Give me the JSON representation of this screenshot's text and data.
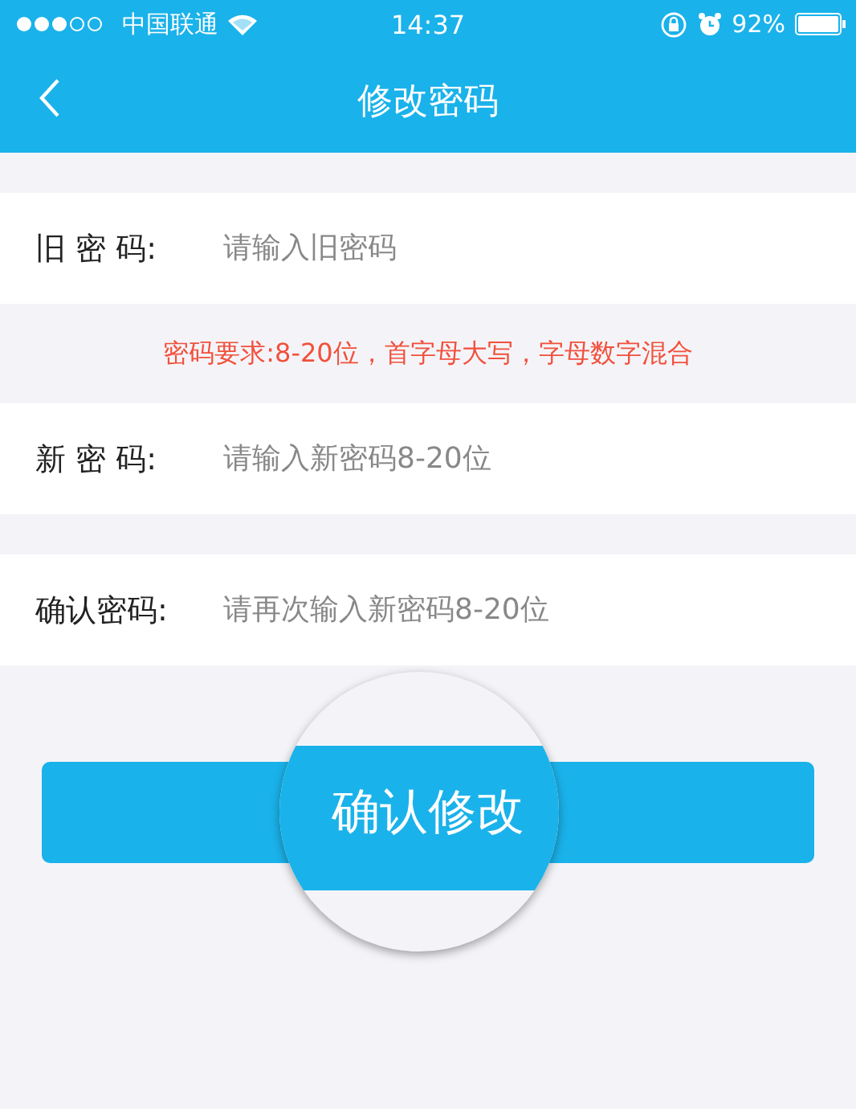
{
  "status_bar": {
    "carrier": "中国联通",
    "time": "14:37",
    "battery": "92%"
  },
  "nav_bar": {
    "title": "修改密码"
  },
  "fields": [
    {
      "label": "旧 密 码:",
      "placeholder": "请输入旧密码"
    },
    {
      "label": "新 密 码:",
      "placeholder": "请输入新密码8-20位",
      "hint": "密码要求:8-20位，首字母大写，字母数字混合"
    },
    {
      "label": "确认密码:",
      "placeholder": "请再次输入新密码8-20位"
    }
  ],
  "submit_button": "确认修改"
}
